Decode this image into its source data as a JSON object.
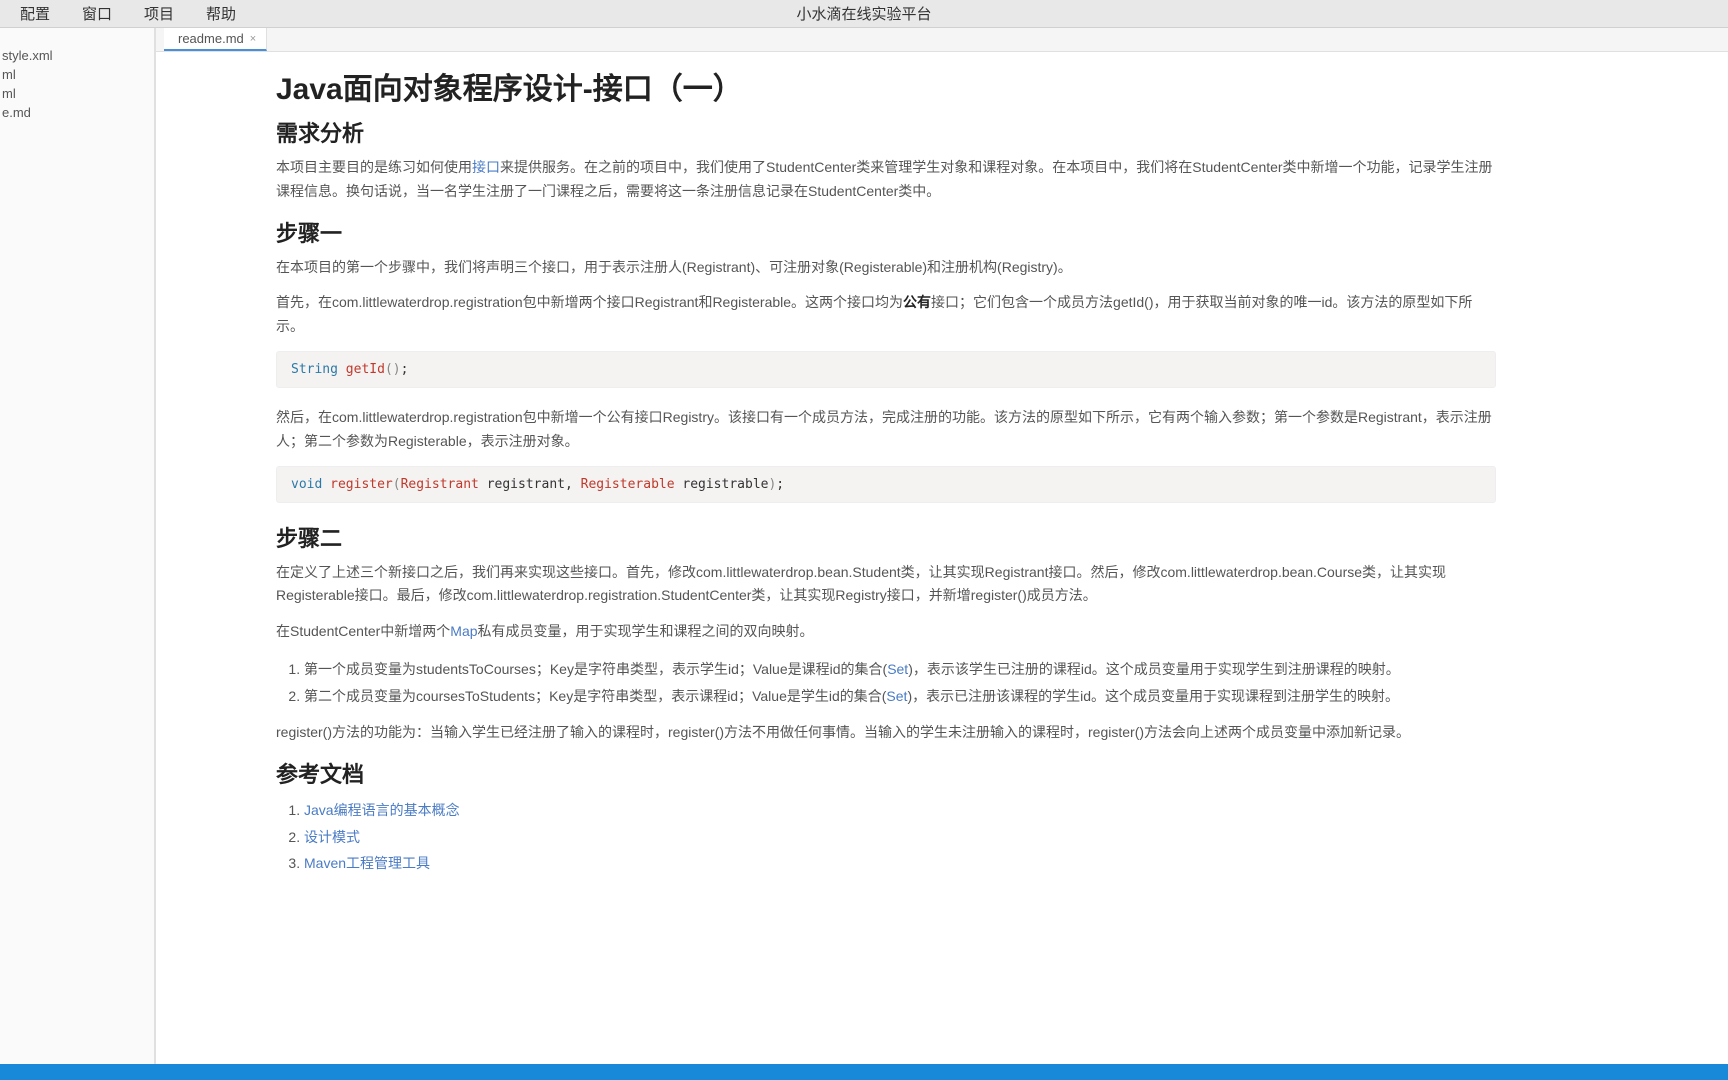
{
  "menubar": {
    "items": [
      "配置",
      "窗口",
      "项目",
      "帮助"
    ],
    "appTitle": "小水滴在线实验平台"
  },
  "sidebar": {
    "files": [
      "style.xml",
      "ml",
      "ml",
      "e.md"
    ]
  },
  "tabs": {
    "active": {
      "label": "readme.md",
      "closeGlyph": "×"
    }
  },
  "doc": {
    "h1": "Java面向对象程序设计-接口（一）",
    "h2_req": "需求分析",
    "p_req_a": "本项目主要目的是练习如何使用",
    "p_req_link": "接口",
    "p_req_b": "来提供服务。在之前的项目中，我们使用了StudentCenter类来管理学生对象和课程对象。在本项目中，我们将在StudentCenter类中新增一个功能，记录学生注册课程信息。换句话说，当一名学生注册了一门课程之后，需要将这一条注册信息记录在StudentCenter类中。",
    "h2_step1": "步骤一",
    "p_step1_1": "在本项目的第一个步骤中，我们将声明三个接口，用于表示注册人(Registrant)、可注册对象(Registerable)和注册机构(Registry)。",
    "p_step1_2a": "首先，在com.littlewaterdrop.registration包中新增两个接口Registrant和Registerable。这两个接口均为",
    "p_step1_2_bold": "公有",
    "p_step1_2b": "接口；它们包含一个成员方法getId()，用于获取当前对象的唯一id。该方法的原型如下所示。",
    "code1": {
      "type": "String",
      "method": "getId",
      "parenOpen": "(",
      "parenClose": ")",
      "semi": ";"
    },
    "p_step1_3": "然后，在com.littlewaterdrop.registration包中新增一个公有接口Registry。该接口有一个成员方法，完成注册的功能。该方法的原型如下所示，它有两个输入参数；第一个参数是Registrant，表示注册人；第二个参数为Registerable，表示注册对象。",
    "code2": {
      "kw": "void",
      "method": "register",
      "po": "(",
      "t1": "Registrant",
      "a1": " registrant",
      "comma": ", ",
      "t2": "Registerable",
      "a2": " registrable",
      "pc": ")",
      "semi": ";"
    },
    "h2_step2": "步骤二",
    "p_step2_1": "在定义了上述三个新接口之后，我们再来实现这些接口。首先，修改com.littlewaterdrop.bean.Student类，让其实现Registrant接口。然后，修改com.littlewaterdrop.bean.Course类，让其实现Registerable接口。最后，修改com.littlewaterdrop.registration.StudentCenter类，让其实现Registry接口，并新增register()成员方法。",
    "p_step2_2a": "在StudentCenter中新增两个",
    "p_step2_2_link": "Map",
    "p_step2_2b": "私有成员变量，用于实现学生和课程之间的双向映射。",
    "ol_step2": [
      {
        "pre": "第一个成员变量为studentsToCourses；Key是字符串类型，表示学生id；Value是课程id的集合(",
        "link": "Set",
        "post": ")，表示该学生已注册的课程id。这个成员变量用于实现学生到注册课程的映射。"
      },
      {
        "pre": "第二个成员变量为coursesToStudents；Key是字符串类型，表示课程id；Value是学生id的集合(",
        "link": "Set",
        "post": ")，表示已注册该课程的学生id。这个成员变量用于实现课程到注册学生的映射。"
      }
    ],
    "p_step2_3": "register()方法的功能为：当输入学生已经注册了输入的课程时，register()方法不用做任何事情。当输入的学生未注册输入的课程时，register()方法会向上述两个成员变量中添加新记录。",
    "h2_refs": "参考文档",
    "refs": [
      "Java编程语言的基本概念",
      "设计模式",
      "Maven工程管理工具"
    ]
  }
}
